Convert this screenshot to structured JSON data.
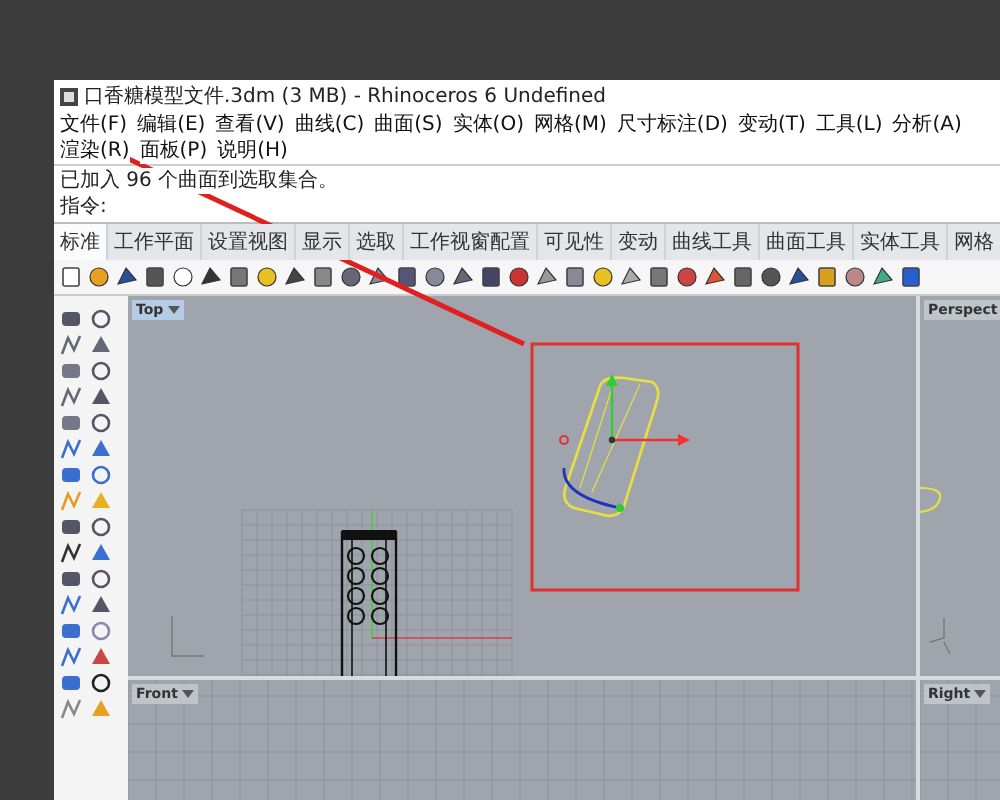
{
  "window": {
    "title": "口香糖模型文件.3dm (3 MB) - Rhinoceros 6 Undefined"
  },
  "menu": [
    "文件(F)",
    "编辑(E)",
    "查看(V)",
    "曲线(C)",
    "曲面(S)",
    "实体(O)",
    "网格(M)",
    "尺寸标注(D)",
    "变动(T)",
    "工具(L)",
    "分析(A)",
    "渲染(R)",
    "面板(P)",
    "说明(H)"
  ],
  "command_lines": [
    "已加入 96 个曲面到选取集合。",
    "指令:"
  ],
  "tabs": [
    {
      "label": "标准",
      "selected": true
    },
    {
      "label": "工作平面",
      "selected": false
    },
    {
      "label": "设置视图",
      "selected": false
    },
    {
      "label": "显示",
      "selected": false
    },
    {
      "label": "选取",
      "selected": false
    },
    {
      "label": "工作视窗配置",
      "selected": false
    },
    {
      "label": "可见性",
      "selected": false
    },
    {
      "label": "变动",
      "selected": false
    },
    {
      "label": "曲线工具",
      "selected": false
    },
    {
      "label": "曲面工具",
      "selected": false
    },
    {
      "label": "实体工具",
      "selected": false
    },
    {
      "label": "网格",
      "selected": false
    }
  ],
  "viewports": [
    {
      "label": "Top",
      "selected": true
    },
    {
      "label": "Perspect",
      "selected": false
    },
    {
      "label": "Front",
      "selected": false
    },
    {
      "label": "Right",
      "selected": false
    }
  ]
}
